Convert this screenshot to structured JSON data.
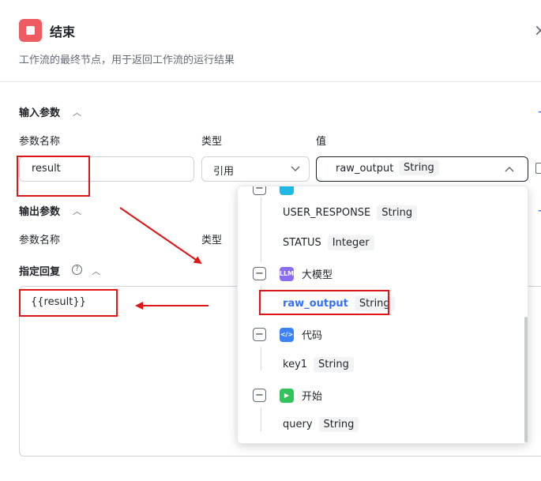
{
  "header": {
    "title": "结束",
    "description": "工作流的最终节点，用于返回工作流的运行结果",
    "close_symbol": "×"
  },
  "inputs": {
    "section_title": "输入参数",
    "col_name": "参数名称",
    "col_type": "类型",
    "col_value": "值",
    "param_name": "result",
    "type_value": "引用",
    "value_name": "raw_output",
    "value_type": "String",
    "add_symbol": "+"
  },
  "outputs": {
    "section_title": "输出参数",
    "col_name": "参数名称",
    "col_type": "类型",
    "add_symbol": "+"
  },
  "reply": {
    "section_title": "指定回复",
    "help_symbol": "?",
    "content": "{{result}}"
  },
  "dropdown": {
    "items": [
      {
        "name": "USER_RESPONSE",
        "type": "String"
      },
      {
        "name": "STATUS",
        "type": "Integer"
      }
    ],
    "groups": [
      {
        "label": "大模型",
        "icon": "llm-icon",
        "icon_text": "LLM",
        "color": "#8b6cf0",
        "var_name": "raw_output",
        "var_type": "String"
      },
      {
        "label": "代码",
        "icon": "code-icon",
        "icon_text": "</>",
        "color": "#3b82f6",
        "var_name": "key1",
        "var_type": "String"
      },
      {
        "label": "开始",
        "icon": "play-icon",
        "icon_text": "▶",
        "color": "#34c35a",
        "var_name": "query",
        "var_type": "String"
      }
    ],
    "collapse_symbol": "−"
  },
  "colors": {
    "accent": "#3370ff",
    "annotation_red": "#e01515",
    "end_node": "#ef5b62"
  }
}
